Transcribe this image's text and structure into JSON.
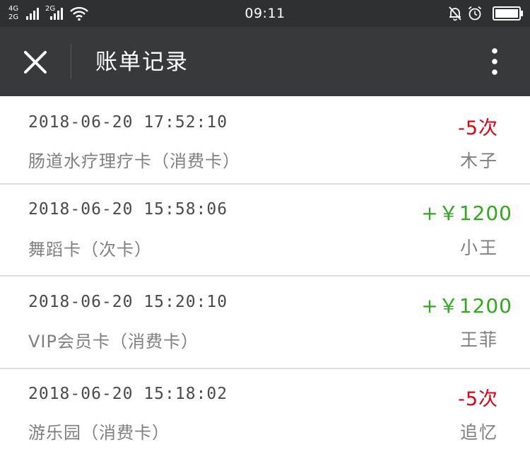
{
  "status_bar": {
    "network_top": "4G",
    "network_bottom": "2G",
    "network_2": "2G",
    "time": "09:11",
    "icons": [
      "signal-icon",
      "signal-icon",
      "wifi-icon",
      "alarm-off-icon",
      "alarm-clock-icon",
      "battery-icon"
    ]
  },
  "header": {
    "title": "账单记录",
    "close_icon": "close-icon",
    "more_icon": "more-vertical-icon"
  },
  "records": [
    {
      "datetime": "2018-06-20 17:52:10",
      "card": "肠道水疗理疗卡（消费卡）",
      "amount": "-5次",
      "type": "neg",
      "person": "木子"
    },
    {
      "datetime": "2018-06-20 15:58:06",
      "card": "舞蹈卡（次卡）",
      "amount": "+￥1200",
      "type": "pos",
      "person": "小王"
    },
    {
      "datetime": "2018-06-20 15:20:10",
      "card": "VIP会员卡（消费卡）",
      "amount": "+￥1200",
      "type": "pos",
      "person": "王菲"
    },
    {
      "datetime": "2018-06-20 15:18:02",
      "card": "游乐园（消费卡）",
      "amount": "-5次",
      "type": "neg",
      "person": "追忆"
    }
  ],
  "colors": {
    "header_bg": "#38393b",
    "status_bg": "#2f3032",
    "negative": "#e50011",
    "positive": "#2eaa1b"
  }
}
